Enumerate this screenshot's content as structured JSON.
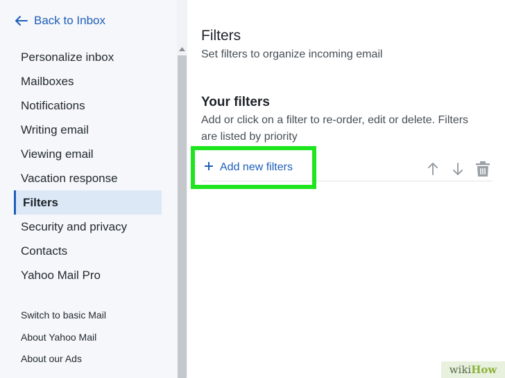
{
  "sidebar": {
    "back_label": "Back to Inbox",
    "items": [
      {
        "label": "Personalize inbox"
      },
      {
        "label": "Mailboxes"
      },
      {
        "label": "Notifications"
      },
      {
        "label": "Writing email"
      },
      {
        "label": "Viewing email"
      },
      {
        "label": "Vacation response"
      },
      {
        "label": "Filters"
      },
      {
        "label": "Security and privacy"
      },
      {
        "label": "Contacts"
      },
      {
        "label": "Yahoo Mail Pro"
      }
    ],
    "active_item": "Filters",
    "footer_items": [
      {
        "label": "Switch to basic Mail"
      },
      {
        "label": "About Yahoo Mail"
      },
      {
        "label": "About our Ads"
      }
    ]
  },
  "main": {
    "title": "Filters",
    "subtitle": "Set filters to organize incoming email",
    "section_title": "Your filters",
    "section_desc": "Add or click on a filter to re-order, edit or delete. Filters are listed by priority",
    "add_filter_label": "Add new filters"
  },
  "icons": {
    "back": "arrow-left-icon",
    "add": "plus-icon",
    "move_up": "arrow-up-icon",
    "move_down": "arrow-down-icon",
    "delete": "trash-icon"
  },
  "colors": {
    "accent": "#1e5eb8",
    "highlight": "#1ee51e",
    "active_bg": "#dce8f6",
    "sidebar_bg": "#f5f7fa"
  },
  "watermark": {
    "prefix": "wiki",
    "suffix": "How"
  }
}
